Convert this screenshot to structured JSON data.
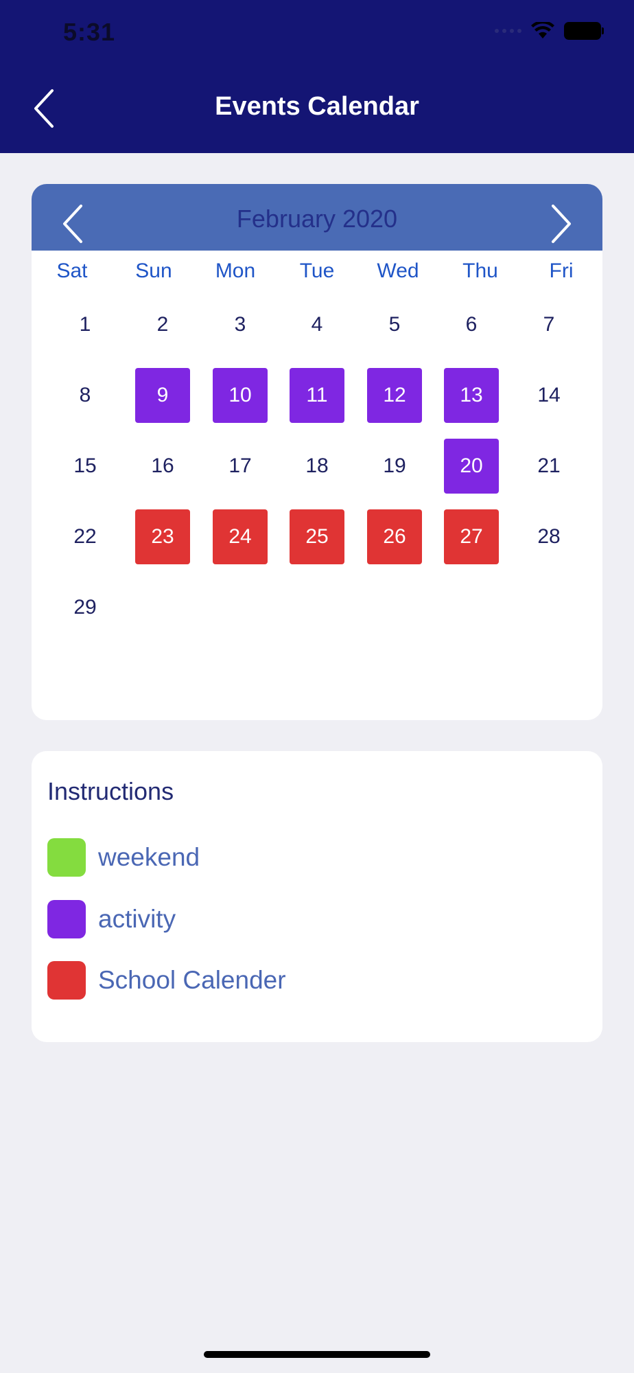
{
  "status_bar": {
    "time": "5:31"
  },
  "nav": {
    "title": "Events Calendar",
    "back_icon": "chevron-left-icon"
  },
  "calendar": {
    "month_label": "February 2020",
    "weekdays": [
      "Sat",
      "Sun",
      "Mon",
      "Tue",
      "Wed",
      "Thu",
      "Fri"
    ],
    "weeks": [
      [
        {
          "d": "1",
          "t": ""
        },
        {
          "d": "2",
          "t": ""
        },
        {
          "d": "3",
          "t": ""
        },
        {
          "d": "4",
          "t": ""
        },
        {
          "d": "5",
          "t": ""
        },
        {
          "d": "6",
          "t": ""
        },
        {
          "d": "7",
          "t": ""
        }
      ],
      [
        {
          "d": "8",
          "t": ""
        },
        {
          "d": "9",
          "t": "activity"
        },
        {
          "d": "10",
          "t": "activity"
        },
        {
          "d": "11",
          "t": "activity"
        },
        {
          "d": "12",
          "t": "activity"
        },
        {
          "d": "13",
          "t": "activity"
        },
        {
          "d": "14",
          "t": ""
        }
      ],
      [
        {
          "d": "15",
          "t": ""
        },
        {
          "d": "16",
          "t": ""
        },
        {
          "d": "17",
          "t": ""
        },
        {
          "d": "18",
          "t": ""
        },
        {
          "d": "19",
          "t": ""
        },
        {
          "d": "20",
          "t": "activity"
        },
        {
          "d": "21",
          "t": ""
        }
      ],
      [
        {
          "d": "22",
          "t": ""
        },
        {
          "d": "23",
          "t": "school"
        },
        {
          "d": "24",
          "t": "school"
        },
        {
          "d": "25",
          "t": "school"
        },
        {
          "d": "26",
          "t": "school"
        },
        {
          "d": "27",
          "t": "school"
        },
        {
          "d": "28",
          "t": ""
        }
      ],
      [
        {
          "d": "29",
          "t": ""
        }
      ]
    ]
  },
  "instructions": {
    "title": "Instructions",
    "items": [
      {
        "label": "weekend",
        "color": "#84dc3f"
      },
      {
        "label": "activity",
        "color": "#7f27e2"
      },
      {
        "label": "School Calender",
        "color": "#e03434"
      }
    ]
  },
  "colors": {
    "header": "#141574",
    "calendar_head": "#4a6bb5",
    "activity": "#7f27e2",
    "school": "#e03434",
    "weekend": "#84dc3f"
  }
}
